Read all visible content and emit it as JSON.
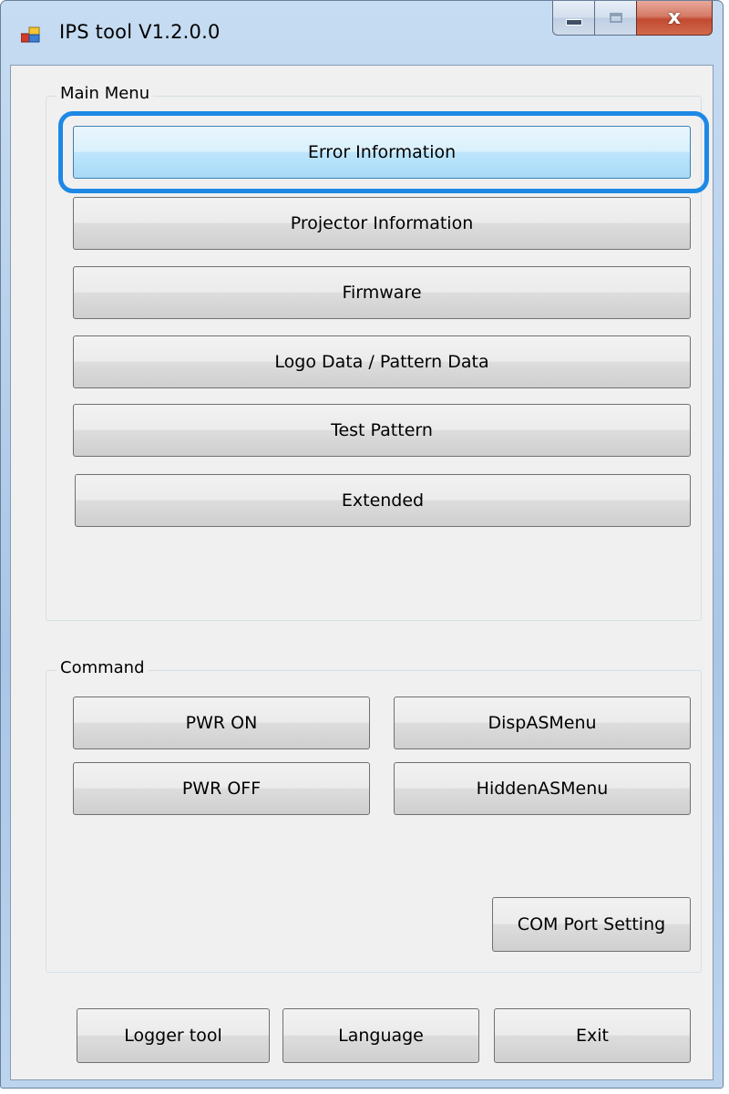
{
  "window": {
    "title": "IPS tool V1.2.0.0",
    "close_glyph": "x",
    "accent_color": "#1e88e5"
  },
  "icons": {
    "app": "app-icon",
    "minimize": "minimize-icon",
    "maximize": "maximize-icon",
    "close": "close-icon"
  },
  "main_menu": {
    "label": "Main Menu",
    "buttons": [
      {
        "label": "Error Information",
        "highlighted": true
      },
      {
        "label": "Projector Information"
      },
      {
        "label": "Firmware"
      },
      {
        "label": "Logo Data / Pattern Data"
      },
      {
        "label": "Test Pattern"
      },
      {
        "label": "Extended"
      }
    ]
  },
  "command": {
    "label": "Command",
    "pwr_on": "PWR ON",
    "pwr_off": "PWR OFF",
    "disp_as_menu": "DispASMenu",
    "hidden_as_menu": "HiddenASMenu",
    "com_port_setting": "COM Port Setting"
  },
  "footer": {
    "logger_tool": "Logger tool",
    "language": "Language",
    "exit": "Exit"
  }
}
